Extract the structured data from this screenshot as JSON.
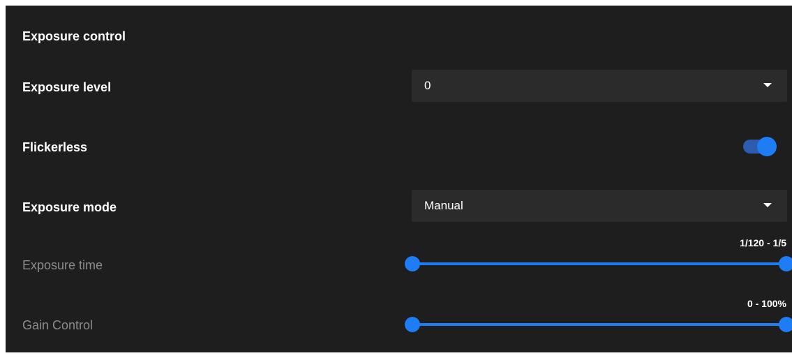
{
  "exposure_control": {
    "section_title": "Exposure control",
    "exposure_level": {
      "label": "Exposure level",
      "value": "0"
    },
    "flickerless": {
      "label": "Flickerless",
      "enabled": true
    },
    "exposure_mode": {
      "label": "Exposure mode",
      "value": "Manual"
    },
    "exposure_time": {
      "label": "Exposure time",
      "range_text": "1/120 - 1/5",
      "range_fraction": [
        0,
        1
      ]
    },
    "gain_control": {
      "label": "Gain Control",
      "range_text": "0 - 100%",
      "range_fraction": [
        0,
        1
      ]
    }
  },
  "colors": {
    "panel_bg": "#1e1e1f",
    "dropdown_bg": "#2b2b2c",
    "accent": "#1e7cf5",
    "toggle_track": "#2c5bb0",
    "dim_label": "#8c8c8e"
  },
  "icons": {
    "dropdown_caret": "caret-down-icon"
  }
}
